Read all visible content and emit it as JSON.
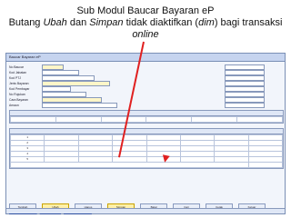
{
  "heading": {
    "line1": "Sub Modul Baucar Bayaran eP",
    "line2_pre": "Butang ",
    "line2_ubah": "Ubah",
    "line2_mid": " dan ",
    "line2_simpan": "Simpan",
    "line2_post": " tidak diaktifkan (",
    "line2_dim": "dim",
    "line2_end": ") bagi transaksi",
    "line3": "online"
  },
  "window": {
    "title": "Baucar Bayaran eP"
  },
  "form": {
    "rows": [
      {
        "label": "No Baucar",
        "value": "",
        "right_label": "",
        "right_value": ""
      },
      {
        "label": "Kod Jabatan",
        "value": "",
        "right_label": "",
        "right_value": ""
      },
      {
        "label": "Kod PTJ",
        "value": "",
        "right_label": "",
        "right_value": ""
      },
      {
        "label": "Jenis Bayaran",
        "value": "",
        "right_label": "",
        "right_value": ""
      },
      {
        "label": "Kod Pembayar",
        "value": "",
        "right_label": "",
        "right_value": ""
      },
      {
        "label": "No Rujukan",
        "value": "",
        "right_label": "",
        "right_value": ""
      },
      {
        "label": "Cara Bayaran",
        "value": "",
        "right_label": "",
        "right_value": ""
      },
      {
        "label": "Amaun",
        "value": "",
        "right_label": "",
        "right_value": ""
      }
    ]
  },
  "panel1": {
    "title": "",
    "row": [
      "",
      "",
      "",
      "",
      "",
      ""
    ]
  },
  "panel2": {
    "title": "",
    "rows": [
      [
        "1",
        "",
        "",
        "",
        "",
        "",
        "",
        ""
      ],
      [
        "2",
        "",
        "",
        "",
        "",
        "",
        "",
        ""
      ],
      [
        "3",
        "",
        "",
        "",
        "",
        "",
        "",
        ""
      ],
      [
        "4",
        "",
        "",
        "",
        "",
        "",
        "",
        ""
      ],
      [
        "5",
        "",
        "",
        "",
        "",
        "",
        "",
        ""
      ]
    ],
    "total": ""
  },
  "buttons": [
    {
      "label": "Tambah",
      "highlight": false
    },
    {
      "label": "Ubah",
      "highlight": true
    },
    {
      "label": "Hapus",
      "highlight": false
    },
    {
      "label": "Simpan",
      "highlight": true
    },
    {
      "label": "Batal",
      "highlight": false
    },
    {
      "label": "Cari",
      "highlight": false
    },
    {
      "label": "Cetak",
      "highlight": false
    },
    {
      "label": "Keluar",
      "highlight": false
    }
  ],
  "tabs": [
    {
      "label": "Maklumat Pengesahan"
    },
    {
      "label": "Maklumat Butiran"
    },
    {
      "label": "Maklumat Pembayaran"
    }
  ],
  "status": {
    "message": ""
  }
}
